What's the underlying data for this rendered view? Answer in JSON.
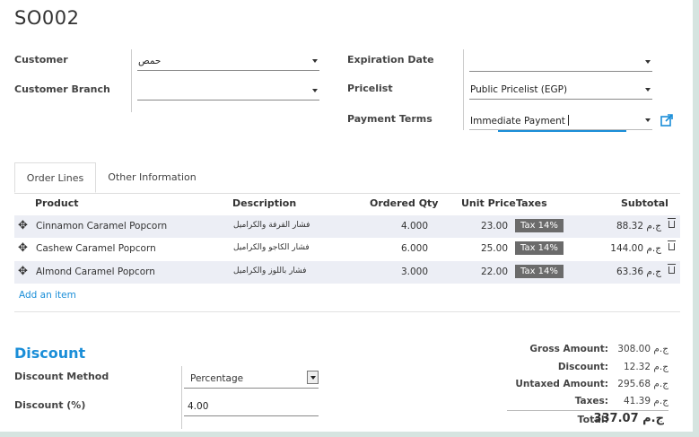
{
  "record": {
    "title": "SO002"
  },
  "form": {
    "customer_label": "Customer",
    "customer_value": "حمص",
    "branch_label": "Customer Branch",
    "branch_value": "",
    "expiration_label": "Expiration Date",
    "expiration_value": "",
    "pricelist_label": "Pricelist",
    "pricelist_value": "Public Pricelist (EGP)",
    "payment_terms_label": "Payment Terms",
    "payment_terms_value": "Immediate Payment"
  },
  "tabs": [
    {
      "label": "Order Lines",
      "active": true
    },
    {
      "label": "Other Information",
      "active": false
    }
  ],
  "table": {
    "headers": {
      "product": "Product",
      "description": "Description",
      "qty": "Ordered Qty",
      "price": "Unit Price",
      "taxes": "Taxes",
      "subtotal": "Subtotal"
    },
    "rows": [
      {
        "product": "Cinnamon Caramel Popcorn",
        "description": "فشار القرفة والكراميل",
        "qty": "4.000",
        "price": "23.00",
        "tax": "Tax 14%",
        "subtotal": "88.32 ج.م"
      },
      {
        "product": "Cashew Caramel Popcorn",
        "description": "فشار الكاجو والكراميل",
        "qty": "6.000",
        "price": "25.00",
        "tax": "Tax 14%",
        "subtotal": "144.00 ج.م"
      },
      {
        "product": "Almond Caramel Popcorn",
        "description": "فشار باللوز والكراميل",
        "qty": "3.000",
        "price": "22.00",
        "tax": "Tax 14%",
        "subtotal": "63.36 ج.م"
      }
    ],
    "add_item": "Add an item"
  },
  "discount": {
    "section_title": "Discount",
    "method_label": "Discount Method",
    "method_value": "Percentage",
    "percent_label": "Discount (%)",
    "percent_value": "4.00"
  },
  "totals": {
    "gross_label": "Gross Amount:",
    "gross_value": "308.00 ج.م",
    "discount_label": "Discount:",
    "discount_value": "12.32 ج.م",
    "untaxed_label": "Untaxed Amount:",
    "untaxed_value": "295.68 ج.م",
    "taxes_label": "Taxes:",
    "taxes_value": "41.39 ج.م",
    "total_label": "Total:",
    "total_value": "337.07 ج.م"
  },
  "colors": {
    "accent": "#1a8ed8",
    "badge": "#6b6b6b",
    "row_stripe": "#eceef5",
    "frame": "#d6e4e0"
  }
}
